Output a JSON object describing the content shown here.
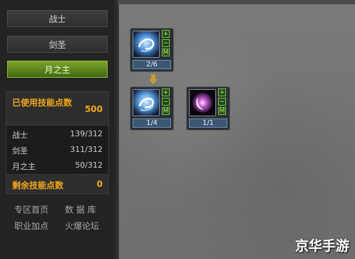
{
  "classes": [
    {
      "label": "战士"
    },
    {
      "label": "剑圣"
    },
    {
      "label": "月之主"
    }
  ],
  "active_class": "月之主",
  "stats": {
    "used_label": "已使用技能点数",
    "used_value": "500",
    "rows": [
      {
        "name": "战士",
        "value": "139/312"
      },
      {
        "name": "剑圣",
        "value": "311/312"
      },
      {
        "name": "月之主",
        "value": "50/312"
      }
    ],
    "remaining_label": "剩余技能点数",
    "remaining_value": "0"
  },
  "links": {
    "home": "专区首页",
    "database": "数 据 库",
    "job_points": "职业加点",
    "forum": "火爆论坛"
  },
  "skill_controls": {
    "plus": "+",
    "minus": "−",
    "max": "M"
  },
  "skills": [
    {
      "level": "2/6",
      "icon": "swirl-skill-icon"
    },
    {
      "level": "1/4",
      "icon": "swirl-skill-icon"
    },
    {
      "level": "1/1",
      "icon": "moon-orb-skill-icon"
    }
  ],
  "watermark": "京华手游",
  "colors": {
    "accent": "#f2a71a",
    "active_tab": "#6a9a22"
  }
}
